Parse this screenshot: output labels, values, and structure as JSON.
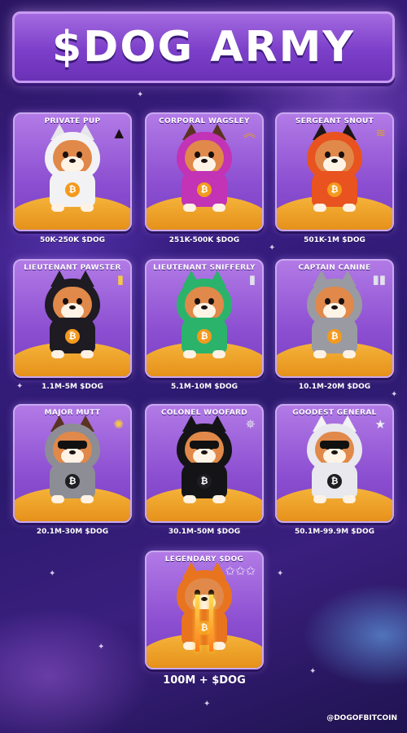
{
  "banner": {
    "title": "$DOG ARMY"
  },
  "ranks": [
    {
      "title": "PRIVATE PUP",
      "range": "50K-250K $DOG",
      "rank_icon": "single-chevron-icon",
      "colors": {
        "hood": "#f2f2f4",
        "ears": "#e6e6ea",
        "accent": "#f39a1e"
      }
    },
    {
      "title": "CORPORAL WAGSLEY",
      "range": "251K-500K $DOG",
      "rank_icon": "double-chevron-icon",
      "colors": {
        "hood": "#c233b5",
        "ears": "#5a3320",
        "accent": "#f39a1e"
      }
    },
    {
      "title": "SERGEANT SNOUT",
      "range": "501K-1M $DOG",
      "rank_icon": "triple-chevron-icon",
      "colors": {
        "hood": "#e8531f",
        "ears": "#1d1616",
        "accent": "#f39a1e"
      }
    },
    {
      "title": "LIEUTENANT PAWSTER",
      "range": "1.1M-5M $DOG",
      "rank_icon": "gold-bar-icon",
      "colors": {
        "hood": "#1e1b22",
        "ears": "#1e1b22",
        "accent": "#f39a1e"
      }
    },
    {
      "title": "LIEUTENANT SNIFFERLY",
      "range": "5.1M-10M $DOG",
      "rank_icon": "silver-bar-icon",
      "colors": {
        "hood": "#2bb36c",
        "ears": "#2bb36c",
        "accent": "#f39a1e"
      }
    },
    {
      "title": "CAPTAIN CANINE",
      "range": "10.1M-20M $DOG",
      "rank_icon": "double-silver-bar-icon",
      "colors": {
        "hood": "#9a9aa2",
        "ears": "#9a9aa2",
        "accent": "#f39a1e"
      }
    },
    {
      "title": "MAJOR MUTT",
      "range": "20.1M-30M $DOG",
      "rank_icon": "gold-leaf-icon",
      "colors": {
        "hood": "#8d8d95",
        "ears": "#5a3320",
        "accent": "#1d1d22"
      }
    },
    {
      "title": "COLONEL WOOFARD",
      "range": "30.1M-50M $DOG",
      "rank_icon": "silver-eagle-icon",
      "colors": {
        "hood": "#141416",
        "ears": "#141416",
        "accent": "#1d1d22"
      }
    },
    {
      "title": "GOODEST GENERAL",
      "range": "50.1M-99.9M $DOG",
      "rank_icon": "general-star-icon",
      "colors": {
        "hood": "#e8e8ee",
        "ears": "#f2f2f4",
        "accent": "#1d1d22"
      }
    }
  ],
  "legendary": {
    "title": "LEGENDARY $DOG",
    "range": "100M + $DOG",
    "rank_icon": "five-stars-icon",
    "colors": {
      "hood": "#e8741f",
      "ears": "#e8741f",
      "accent": "#f39a1e"
    }
  },
  "handle": "@DOGOFBITCOIN",
  "colors": {
    "background": "#2b1a6e",
    "card": "#8c4fd1",
    "ground": "#f5b43a",
    "banner": "#7c3fc9"
  }
}
